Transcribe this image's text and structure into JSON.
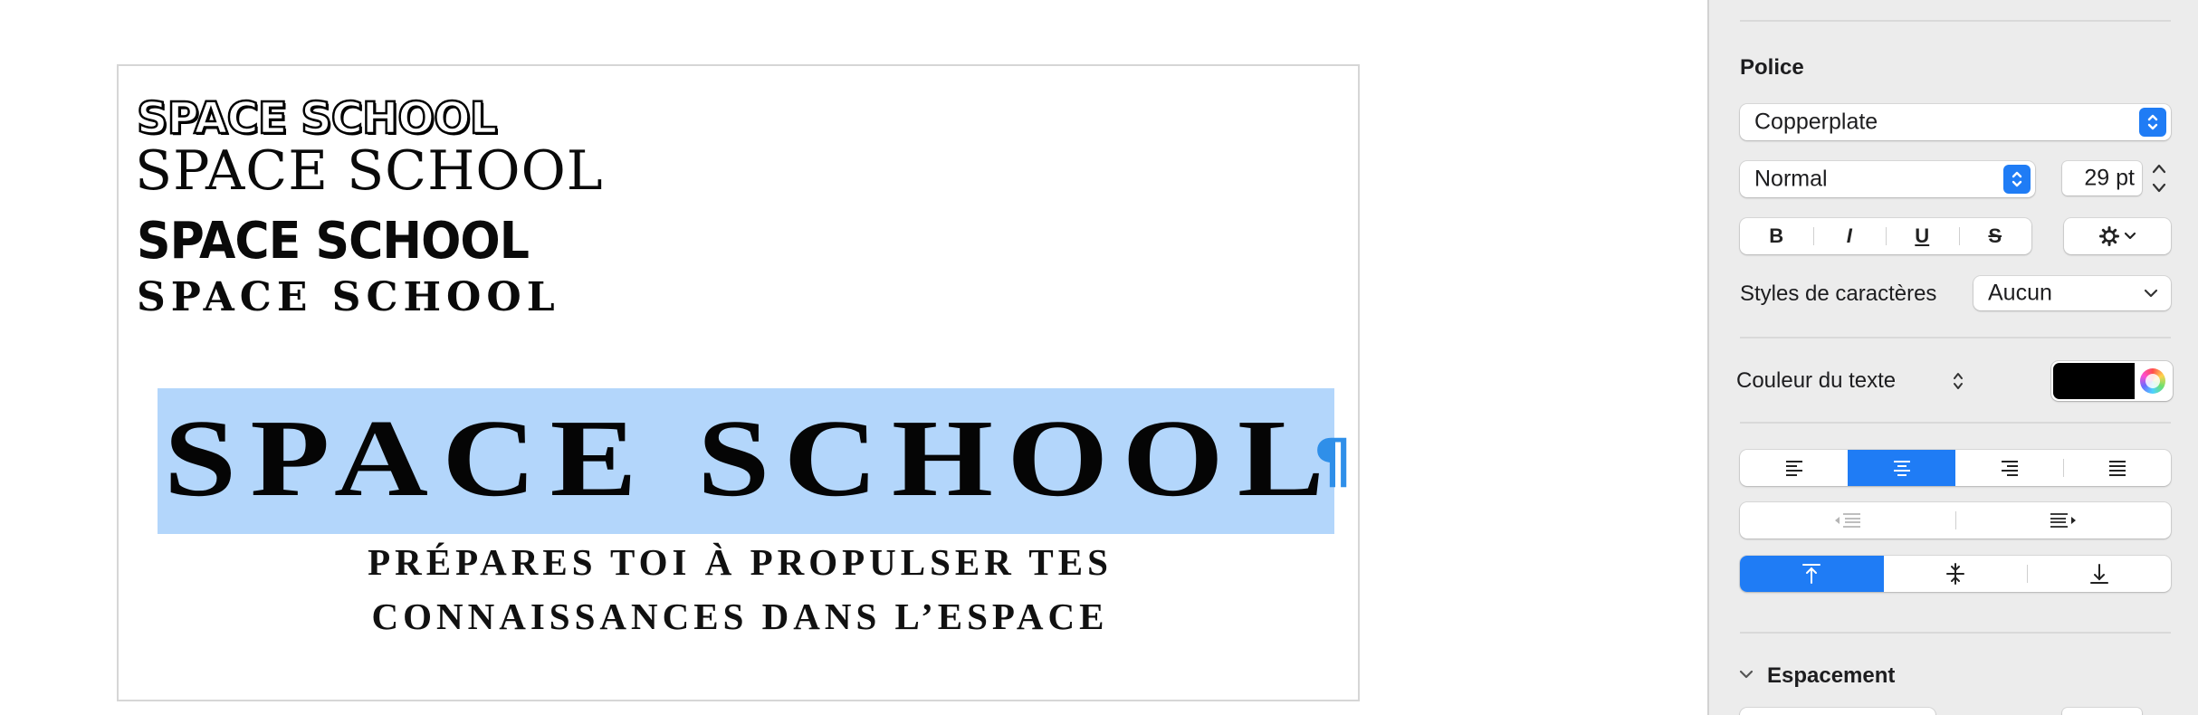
{
  "document": {
    "samples": [
      "SPACE SCHOOL",
      "SPACE SCHOOL",
      "SPACE SCHOOL",
      "SPACE SCHOOL"
    ],
    "title": "SPACE SCHOOL",
    "pilcrow": "¶",
    "subtitle_line1": "PRÉPARES TOI À PROPULSER TES",
    "subtitle_line2": "CONNAISSANCES DANS L’ESPACE"
  },
  "inspector": {
    "font_section_label": "Police",
    "font_family": "Copperplate",
    "font_typeface": "Normal",
    "font_size": "29 pt",
    "style_buttons": [
      "B",
      "I",
      "U",
      "S"
    ],
    "character_styles_label": "Styles de caractères",
    "character_styles_value": "Aucun",
    "text_color_label": "Couleur du texte",
    "text_color_value": "#000000",
    "alignment_selected": "center",
    "vertical_alignment_selected": "top",
    "spacing_label": "Espacement"
  },
  "colors": {
    "accent": "#1f7cf5",
    "selection": "#b3d6fb",
    "pilcrow": "#2f8fe9"
  }
}
